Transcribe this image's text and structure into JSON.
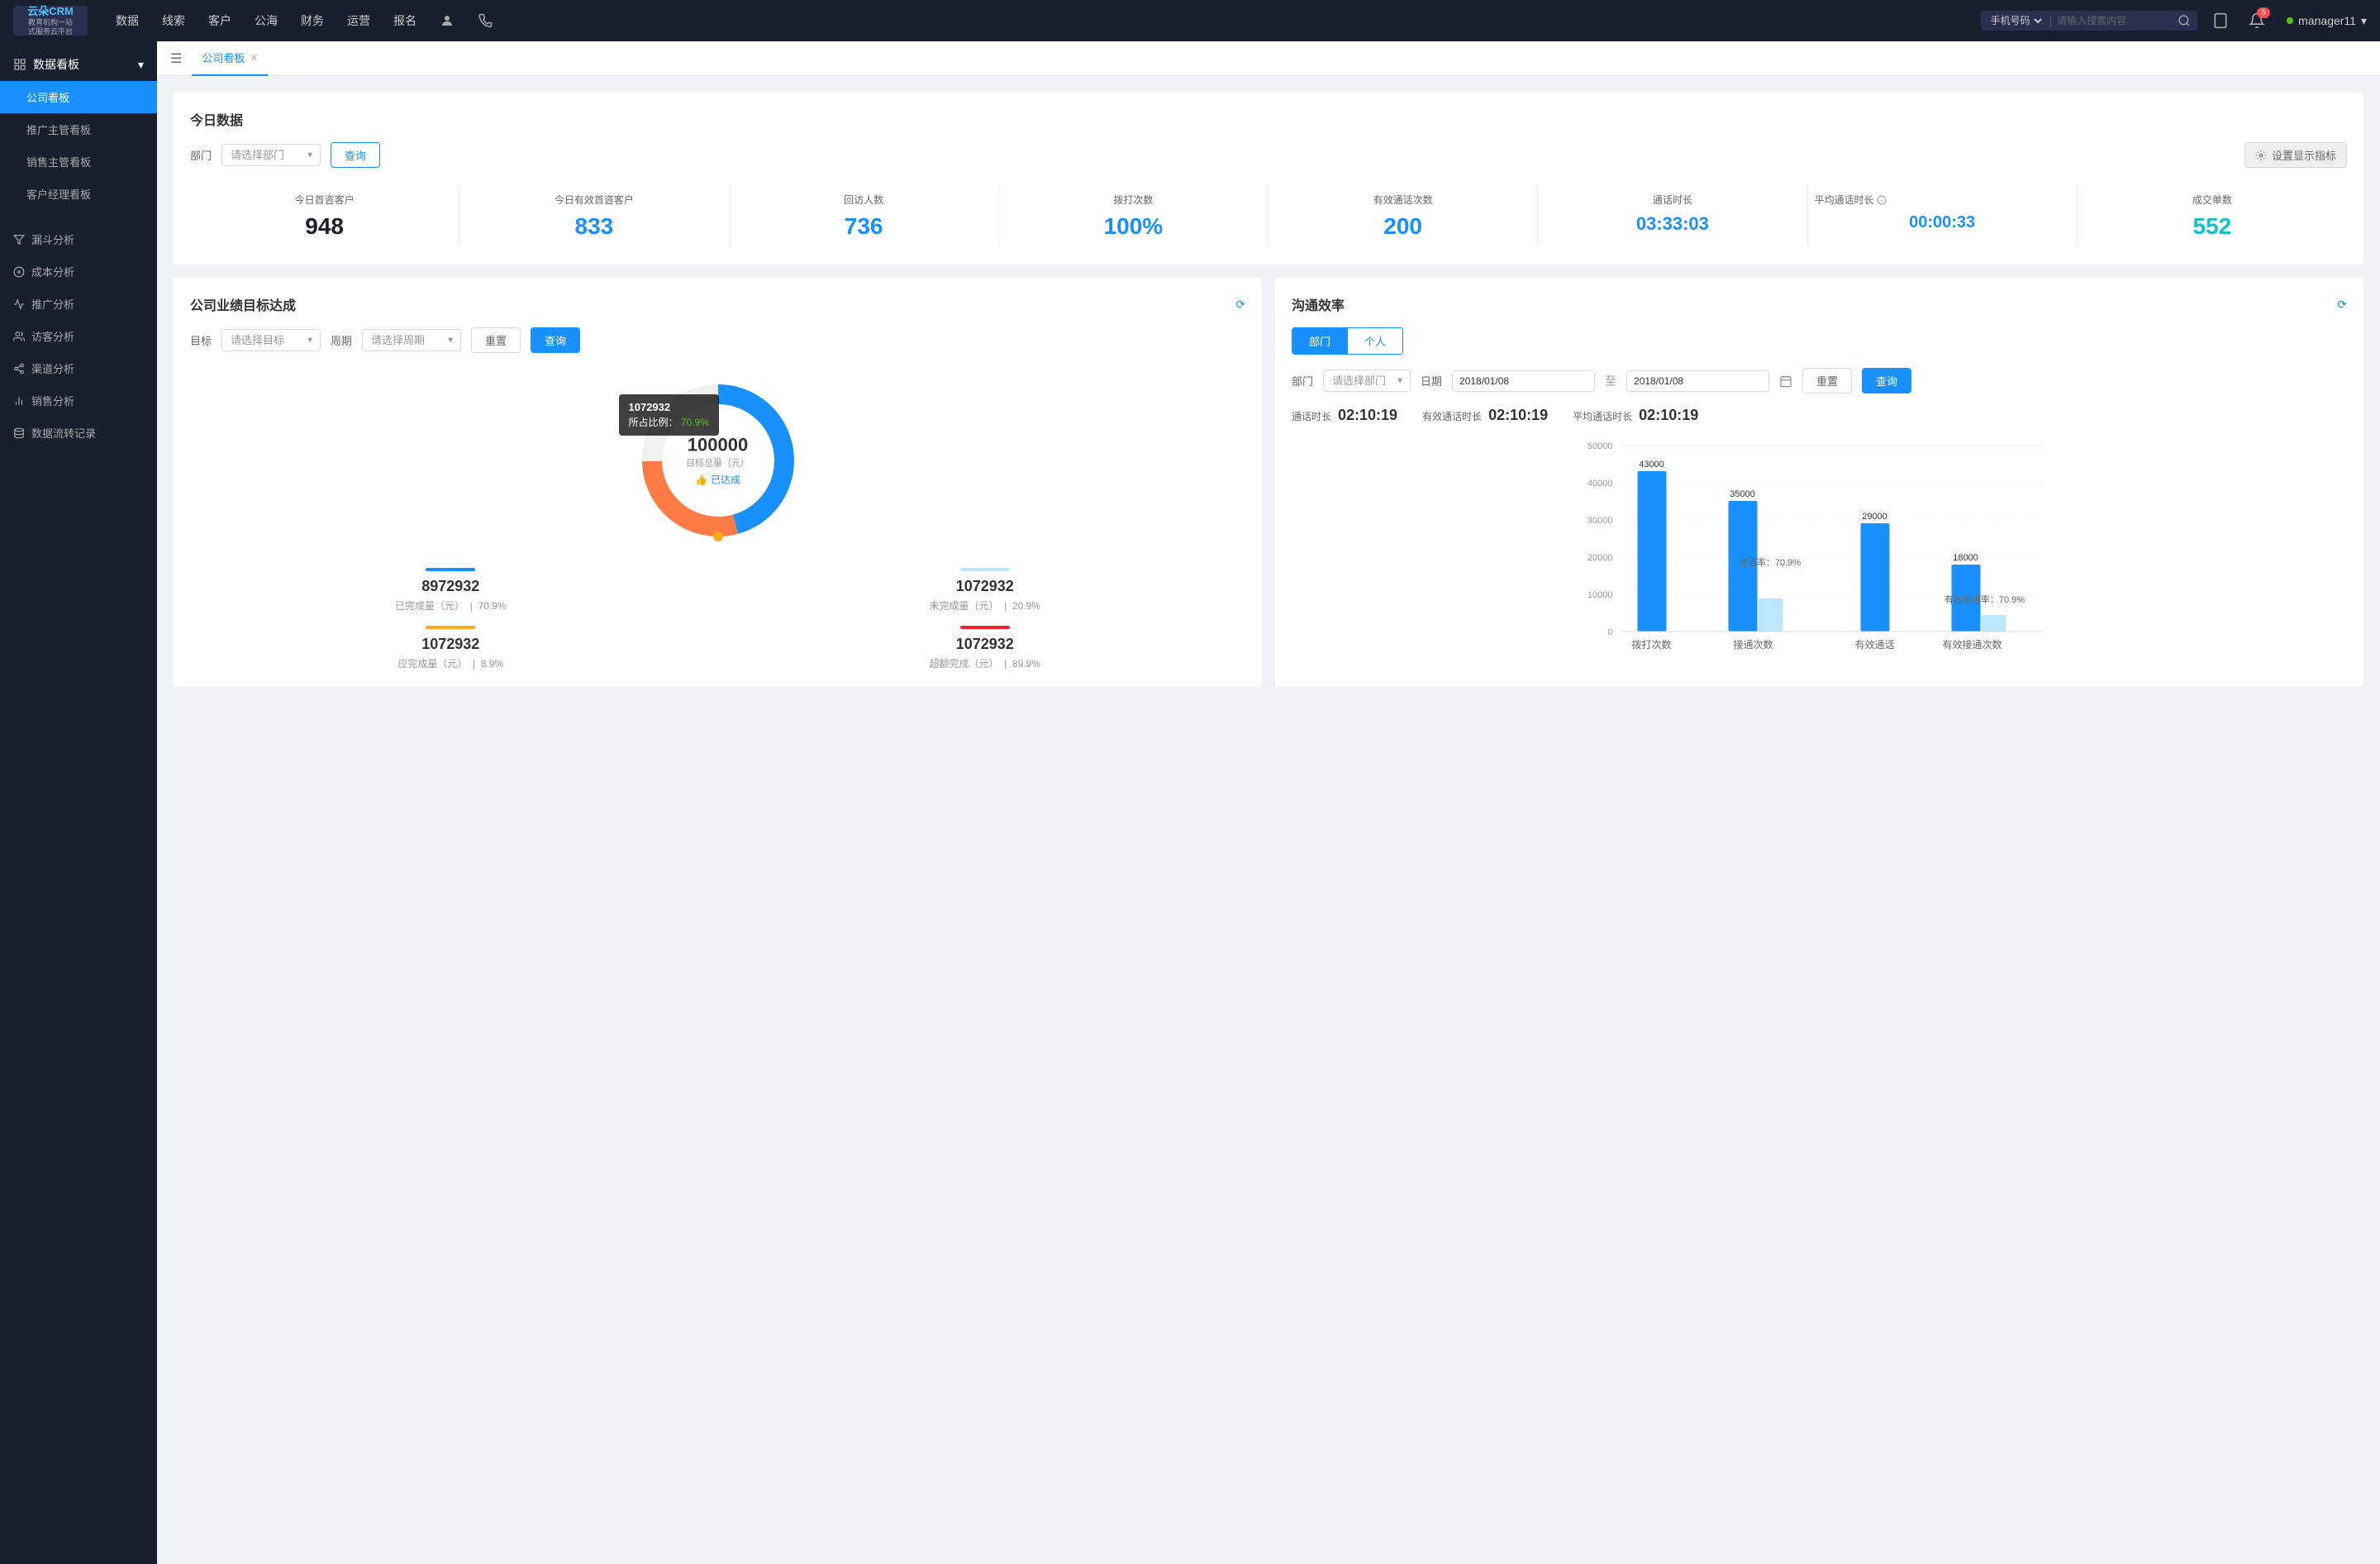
{
  "app": {
    "logo_line1": "云朵CRM",
    "logo_line2": "教育机构一站",
    "logo_line3": "式服务云平台"
  },
  "topnav": {
    "items": [
      "数据",
      "线索",
      "客户",
      "公海",
      "财务",
      "运营",
      "报名"
    ],
    "search_placeholder": "请输入搜索内容",
    "search_select": "手机号码",
    "notification_count": "5",
    "username": "manager11"
  },
  "sidebar": {
    "section_title": "数据看板",
    "items": [
      {
        "label": "公司看板",
        "active": true
      },
      {
        "label": "推广主管看板",
        "active": false
      },
      {
        "label": "销售主管看板",
        "active": false
      },
      {
        "label": "客户经理看板",
        "active": false
      },
      {
        "label": "漏斗分析",
        "active": false
      },
      {
        "label": "成本分析",
        "active": false
      },
      {
        "label": "推广分析",
        "active": false
      },
      {
        "label": "访客分析",
        "active": false
      },
      {
        "label": "渠道分析",
        "active": false
      },
      {
        "label": "销售分析",
        "active": false
      },
      {
        "label": "数据流转记录",
        "active": false
      }
    ]
  },
  "tab": {
    "label": "公司看板"
  },
  "today_section": {
    "title": "今日数据",
    "dept_label": "部门",
    "dept_placeholder": "请选择部门",
    "query_btn": "查询",
    "setting_btn": "设置显示指标",
    "stats": [
      {
        "label": "今日首咨客户",
        "value": "948",
        "color": "dark"
      },
      {
        "label": "今日有效首咨客户",
        "value": "833",
        "color": "blue"
      },
      {
        "label": "回访人数",
        "value": "736",
        "color": "blue"
      },
      {
        "label": "拨打次数",
        "value": "100%",
        "color": "blue"
      },
      {
        "label": "有效通话次数",
        "value": "200",
        "color": "blue"
      },
      {
        "label": "通话时长",
        "value": "03:33:03",
        "color": "blue"
      },
      {
        "label": "平均通话时长",
        "value": "00:00:33",
        "color": "blue"
      },
      {
        "label": "成交单数",
        "value": "552",
        "color": "cyan"
      }
    ]
  },
  "goal_section": {
    "title": "公司业绩目标达成",
    "goal_label": "目标",
    "goal_placeholder": "请选择目标",
    "period_label": "周期",
    "period_placeholder": "请选择周期",
    "reset_btn": "重置",
    "query_btn": "查询",
    "donut": {
      "center_value": "100000",
      "center_label": "目标总量（元）",
      "achieved_label": "已达成",
      "tooltip_value": "1072932",
      "tooltip_percent": "70.9%",
      "tooltip_label": "所占比例："
    },
    "bottom_stats": [
      {
        "label": "已完成量（元）",
        "sub": "70.9%",
        "value": "8972932",
        "color": "#1890ff"
      },
      {
        "label": "未完成量（元）",
        "sub": "20.9%",
        "value": "1072932",
        "color": "#bae7ff"
      },
      {
        "label": "应完成量（元）",
        "sub": "8.9%",
        "value": "1072932",
        "color": "#faad14"
      },
      {
        "label": "超额完成（元）",
        "sub": "89.9%",
        "value": "1072932",
        "color": "#f5222d"
      }
    ]
  },
  "comm_section": {
    "title": "沟通效率",
    "tabs": [
      "部门",
      "个人"
    ],
    "active_tab": 0,
    "dept_label": "部门",
    "dept_placeholder": "请选择部门",
    "date_label": "日期",
    "date_start": "2018/01/08",
    "date_end": "2018/01/08",
    "reset_btn": "重置",
    "query_btn": "查询",
    "comm_stats": [
      {
        "label": "通话时长",
        "value": "02:10:19"
      },
      {
        "label": "有效通话时长",
        "value": "02:10:19"
      },
      {
        "label": "平均通话时长",
        "value": "02:10:19"
      }
    ],
    "chart": {
      "y_labels": [
        "50000",
        "40000",
        "30000",
        "20000",
        "10000",
        "0"
      ],
      "groups": [
        {
          "label": "拨打次数",
          "bars": [
            {
              "value": 43000,
              "label": "43000",
              "type": "blue",
              "height_pct": 86
            },
            {
              "value": 0,
              "label": "",
              "type": "light",
              "height_pct": 0
            }
          ]
        },
        {
          "label": "接通次数",
          "rate_label": "接通率：70.9%",
          "bars": [
            {
              "value": 35000,
              "label": "35000",
              "type": "blue",
              "height_pct": 70
            },
            {
              "value": 0,
              "label": "",
              "type": "light",
              "height_pct": 18
            }
          ]
        },
        {
          "label": "有效通话",
          "bars": [
            {
              "value": 29000,
              "label": "29000",
              "type": "blue",
              "height_pct": 58
            },
            {
              "value": 0,
              "label": "",
              "type": "light",
              "height_pct": 0
            }
          ]
        },
        {
          "label": "有效接通次数",
          "rate_label": "有效接通率：70.9%",
          "bars": [
            {
              "value": 18000,
              "label": "18000",
              "type": "blue",
              "height_pct": 36
            },
            {
              "value": 0,
              "label": "",
              "type": "light",
              "height_pct": 8
            }
          ]
        }
      ]
    }
  }
}
